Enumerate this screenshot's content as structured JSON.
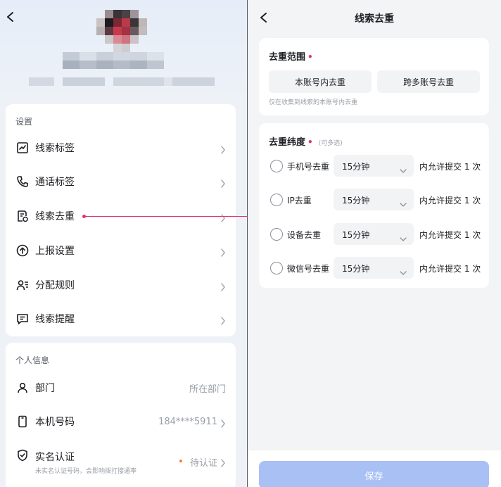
{
  "left": {
    "settings": {
      "section_title": "设置",
      "items": [
        {
          "label": "线索标签",
          "icon": "chart-tag-icon"
        },
        {
          "label": "通话标签",
          "icon": "phone-icon"
        },
        {
          "label": "线索去重",
          "icon": "document-dedupe-icon"
        },
        {
          "label": "上报设置",
          "icon": "upload-circle-icon"
        },
        {
          "label": "分配规则",
          "icon": "user-list-icon"
        },
        {
          "label": "线索提醒",
          "icon": "message-icon"
        }
      ]
    },
    "personal": {
      "section_title": "个人信息",
      "items": [
        {
          "label": "部门",
          "value": "所在部门",
          "icon": "person-icon"
        },
        {
          "label": "本机号码",
          "value": "184****5911",
          "icon": "mobile-icon"
        },
        {
          "label": "实名认证",
          "value": "待认证",
          "sub": "未实名认证号码，会影响拨打接通率",
          "icon": "shield-check-icon"
        }
      ]
    }
  },
  "right": {
    "title": "线索去重",
    "scope": {
      "title": "去重范围",
      "required": "•",
      "options": [
        "本账号内去重",
        "跨多账号去重"
      ],
      "note": "仅在收集到线索的本账号内去重"
    },
    "dimension": {
      "title": "去重纬度",
      "required": "•",
      "hint": "(可多选)",
      "rows": [
        {
          "label": "手机号去重",
          "select": "15分钟",
          "suffix": "内允许提交 1 次"
        },
        {
          "label": "IP去重",
          "select": "15分钟",
          "suffix": "内允许提交 1 次"
        },
        {
          "label": "设备去重",
          "select": "15分钟",
          "suffix": "内允许提交 1 次"
        },
        {
          "label": "微信号去重",
          "select": "15分钟",
          "suffix": "内允许提交 1 次"
        }
      ]
    },
    "save_label": "保存"
  },
  "colors": {
    "accent": "#e2336b",
    "save_button": "#a9c0f5",
    "background": "#f3f4f6"
  }
}
